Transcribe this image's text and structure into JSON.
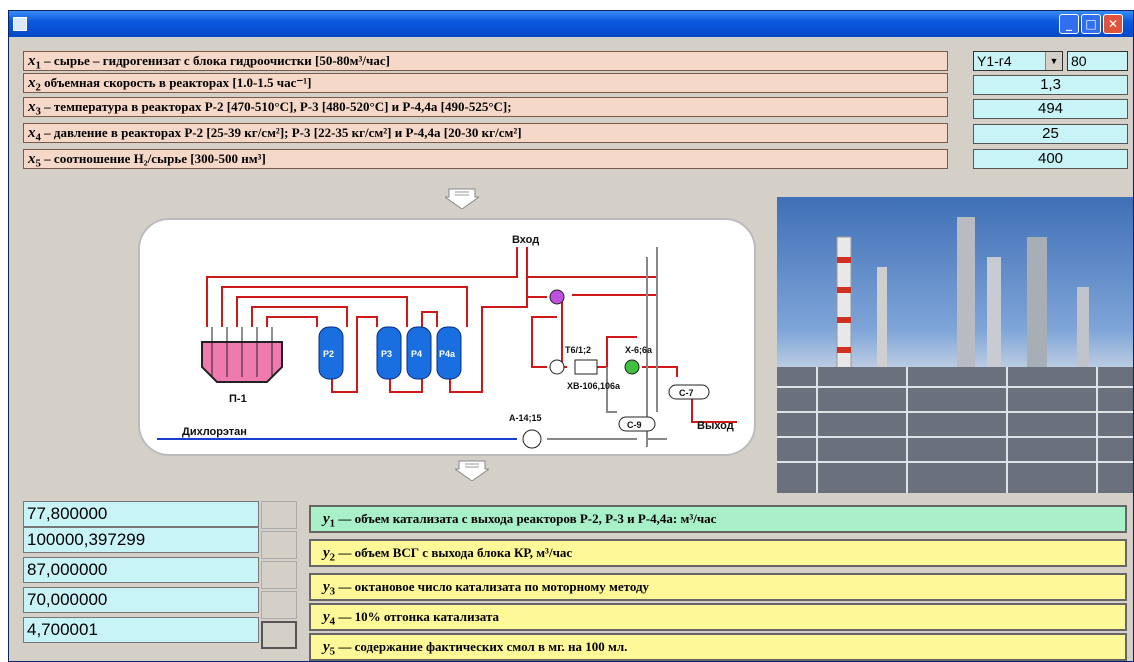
{
  "window": {
    "minimize_icon": "minimize-icon",
    "maximize_icon": "maximize-icon",
    "close_icon": "close-icon"
  },
  "inputs": {
    "rows": [
      {
        "var": "x",
        "sub": "1",
        "text": " – сырье – гидрогенизат с блока гидроочистки [50-80м³/час]"
      },
      {
        "var": "x",
        "sub": "2",
        "text": "  объемная скорость в реакторах [1.0-1.5 час⁻¹]"
      },
      {
        "var": "x",
        "sub": "3",
        "text": " – температура в реакторах Р-2 [470-510°C], Р-3 [480-520°C] и Р-4,4а [490-525°C];"
      },
      {
        "var": "x",
        "sub": "4",
        "text": " – давление в реакторах Р-2 [25-39 кг/см²]; Р-3 [22-35 кг/см²] и Р-4,4а [20-30 кг/см²]"
      },
      {
        "var": "x",
        "sub": "5",
        "text": " – соотношение Н₂/сырье [300-500 нм³]"
      }
    ],
    "selector": "Y1-г4",
    "values": [
      "80",
      "1,3",
      "494",
      "25",
      "400"
    ]
  },
  "scheme": {
    "input_label": "Вход",
    "output_label": "Выход",
    "solvent_label": "Дихлорэтан",
    "furnace_label": "П-1",
    "reactors": [
      "Р2",
      "Р3",
      "Р4",
      "Р4а"
    ],
    "heat_exchanger": "Т6/1;2",
    "air_cooler": "ХВ-106,106а",
    "cooler": "Х-6;6а",
    "column_c7": "С-7",
    "column_c9": "С-9",
    "pump": "А-14;15"
  },
  "outputs": {
    "values": [
      "77,800000",
      "100000,397299",
      "87,000000",
      "70,000000",
      "4,700001"
    ],
    "rows": [
      {
        "var": "y",
        "sub": "1",
        "text": " — объем катализата с выхода реакторов Р-2, Р-3 и Р-4,4а: м³/час"
      },
      {
        "var": "y",
        "sub": "2",
        "text": " — объем ВСГ с выхода блока КР, м³/час"
      },
      {
        "var": "y",
        "sub": "3",
        "text": " — октановое число катализата по моторному методу"
      },
      {
        "var": "y",
        "sub": "4",
        "text": " — 10% отгонка катализата"
      },
      {
        "var": "y",
        "sub": "5",
        "text": " — содержание фактических смол в мг. на 100 мл."
      }
    ]
  },
  "colors": {
    "input_row_bg": "#f5d8c8",
    "value_bg": "#c8f4f8",
    "output_row_yellow": "#fff899",
    "output_row_green": "#a8f0c8",
    "pipe_red": "#d01818",
    "reactor_blue": "#1a6fe0"
  }
}
